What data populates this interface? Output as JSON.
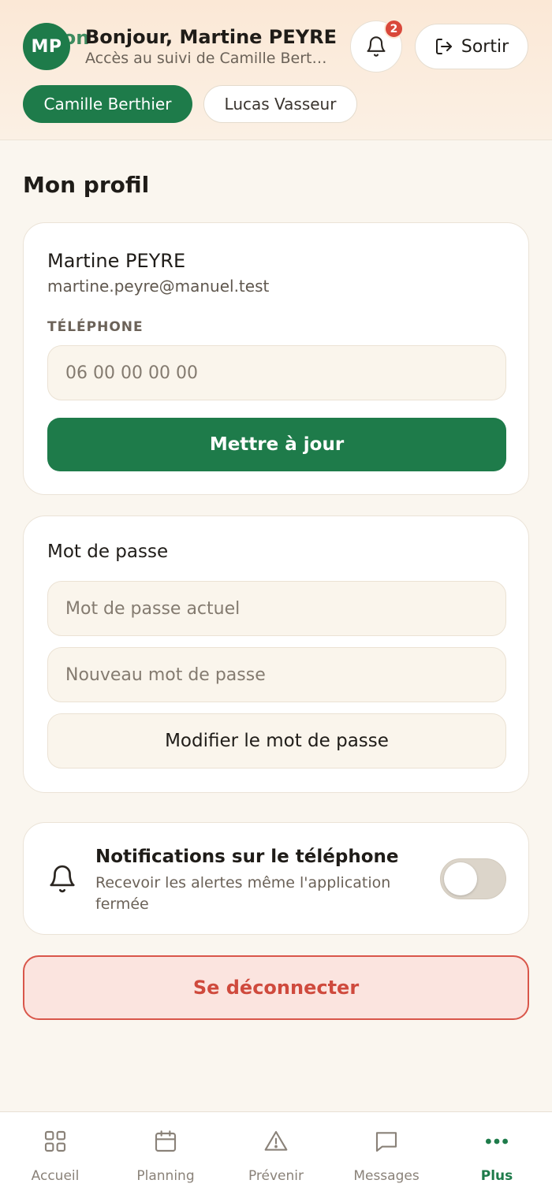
{
  "header": {
    "avatar_initials": "MP",
    "brand_ghost": "eton",
    "greeting": "Bonjour, Martine PEYRE",
    "subgreeting": "Accès au suivi de Camille Berth…",
    "notification_count": "2",
    "logout_label": "Sortir",
    "chips": [
      {
        "label": "Camille Berthier",
        "active": true
      },
      {
        "label": "Lucas Vasseur",
        "active": false
      }
    ]
  },
  "page": {
    "title": "Mon profil"
  },
  "profile": {
    "name": "Martine PEYRE",
    "email": "martine.peyre@manuel.test",
    "phone_label": "TÉLÉPHONE",
    "phone_value": "",
    "phone_placeholder": "06 00 00 00 00",
    "update_label": "Mettre à jour"
  },
  "password": {
    "title": "Mot de passe",
    "current_placeholder": "Mot de passe actuel",
    "new_placeholder": "Nouveau mot de passe",
    "submit_label": "Modifier le mot de passe"
  },
  "notifications": {
    "title": "Notifications sur le téléphone",
    "description": "Recevoir les alertes même l'application fermée",
    "enabled": false
  },
  "signout_label": "Se déconnecter",
  "nav": {
    "items": [
      {
        "label": "Accueil",
        "icon": "grid-icon"
      },
      {
        "label": "Planning",
        "icon": "calendar-icon"
      },
      {
        "label": "Prévenir",
        "icon": "warning-icon"
      },
      {
        "label": "Messages",
        "icon": "chat-icon"
      },
      {
        "label": "Plus",
        "icon": "more-icon",
        "active": true
      }
    ]
  },
  "colors": {
    "brand": "#1e7b4a",
    "danger": "#d9564a",
    "badge": "#d9483b"
  }
}
